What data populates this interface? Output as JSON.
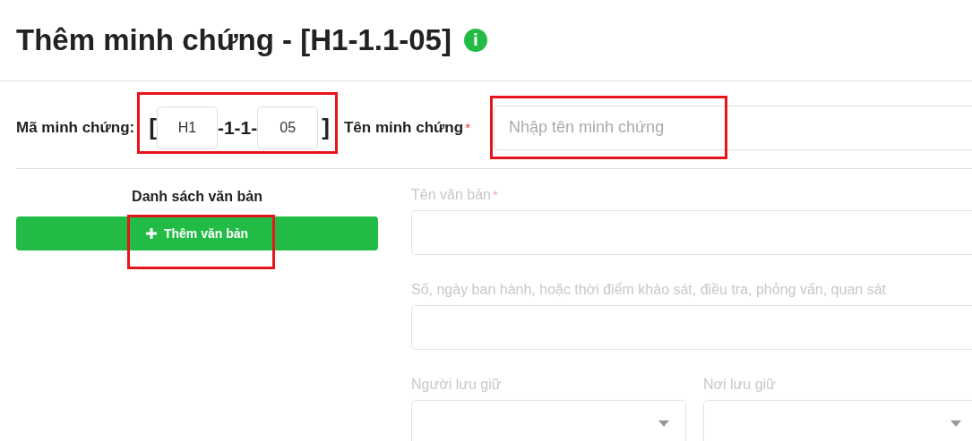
{
  "header": {
    "title": "Thêm minh chứng - [H1-1.1-05]",
    "info_icon": "i"
  },
  "code_row": {
    "label": "Mã minh chứng:",
    "open_bracket": "[",
    "prefix": "H1",
    "middle": "-1-1-",
    "number": "05",
    "close_bracket": "]",
    "name_label": "Tên minh chứng",
    "name_required": "*",
    "name_placeholder": "Nhập tên minh chứng"
  },
  "documents": {
    "title": "Danh sách văn bản",
    "add_button": "Thêm văn bản"
  },
  "document_form": {
    "disabled": true,
    "fields": [
      {
        "kind": "text",
        "label": "Tên văn bản",
        "required_mark": "*"
      },
      {
        "kind": "text",
        "label": "Số, ngày ban hành, hoặc thời điểm khảo sát, điều tra, phỏng vấn, quan sát"
      },
      {
        "kind": "select_pair",
        "labels": [
          "Người lưu giữ",
          "Nơi lưu giữ"
        ]
      }
    ]
  },
  "highlights": [
    {
      "kind": "code"
    },
    {
      "kind": "name_field"
    },
    {
      "kind": "add_button"
    }
  ]
}
